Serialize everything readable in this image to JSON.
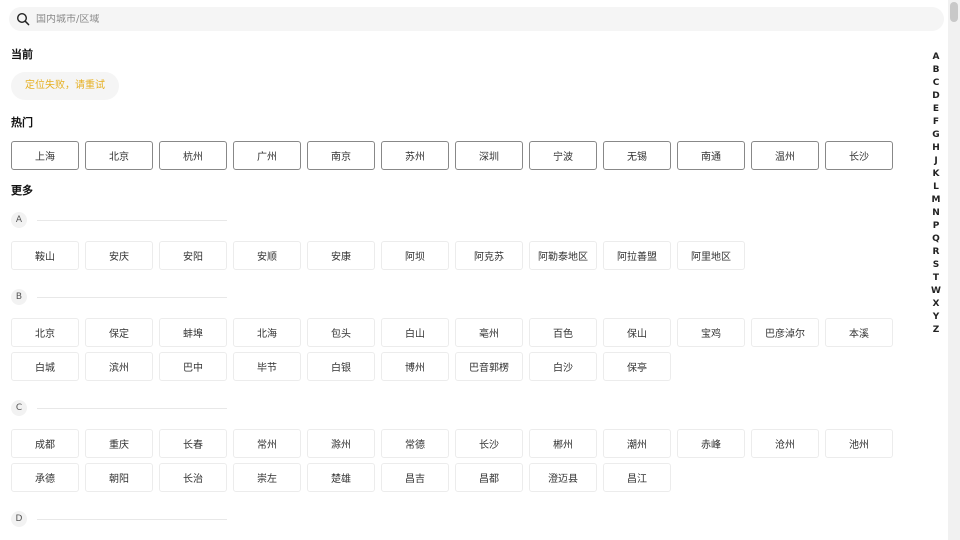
{
  "search": {
    "placeholder": "国内城市/区域"
  },
  "current": {
    "title": "当前",
    "location_text": "定位失败，请重试"
  },
  "hot": {
    "title": "热门",
    "cities": [
      "上海",
      "北京",
      "杭州",
      "广州",
      "南京",
      "苏州",
      "深圳",
      "宁波",
      "无锡",
      "南通",
      "温州",
      "长沙"
    ]
  },
  "more": {
    "title": "更多",
    "groups": [
      {
        "letter": "A",
        "cities": [
          "鞍山",
          "安庆",
          "安阳",
          "安顺",
          "安康",
          "阿坝",
          "阿克苏",
          "阿勒泰地区",
          "阿拉善盟",
          "阿里地区"
        ]
      },
      {
        "letter": "B",
        "cities": [
          "北京",
          "保定",
          "蚌埠",
          "北海",
          "包头",
          "白山",
          "亳州",
          "百色",
          "保山",
          "宝鸡",
          "巴彦淖尔",
          "本溪",
          "白城",
          "滨州",
          "巴中",
          "毕节",
          "白银",
          "博州",
          "巴音郭楞",
          "白沙",
          "保亭"
        ]
      },
      {
        "letter": "C",
        "cities": [
          "成都",
          "重庆",
          "长春",
          "常州",
          "滁州",
          "常德",
          "长沙",
          "郴州",
          "潮州",
          "赤峰",
          "沧州",
          "池州",
          "承德",
          "朝阳",
          "长治",
          "崇左",
          "楚雄",
          "昌吉",
          "昌都",
          "澄迈县",
          "昌江"
        ]
      },
      {
        "letter": "D",
        "cities": []
      }
    ]
  },
  "alphabet": [
    "A",
    "B",
    "C",
    "D",
    "E",
    "F",
    "G",
    "H",
    "J",
    "K",
    "L",
    "M",
    "N",
    "P",
    "Q",
    "R",
    "S",
    "T",
    "W",
    "X",
    "Y",
    "Z"
  ],
  "colors": {
    "location_text": "#e6b022",
    "hot_border": "#888888",
    "chip_border": "#ececec"
  }
}
